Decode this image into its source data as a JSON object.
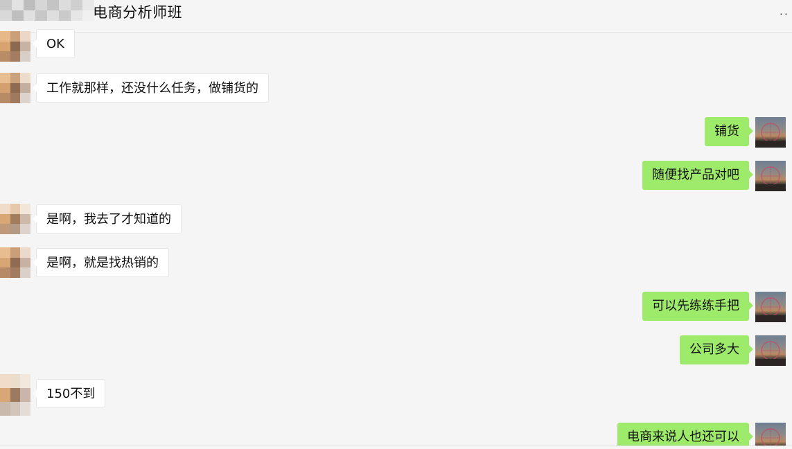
{
  "header": {
    "title": "电商分析师班",
    "more_label": "··"
  },
  "messages": [
    {
      "side": "left",
      "text": "OK"
    },
    {
      "side": "left",
      "text": "工作就那样，还没什么任务，做铺货的"
    },
    {
      "side": "right",
      "text": "铺货"
    },
    {
      "side": "right",
      "text": "随便找产品对吧"
    },
    {
      "side": "left",
      "text": "是啊，我去了才知道的"
    },
    {
      "side": "left",
      "text": "是啊，就是找热销的"
    },
    {
      "side": "right",
      "text": "可以先练练手把"
    },
    {
      "side": "right",
      "text": "公司多大"
    },
    {
      "side": "left",
      "text": "150不到"
    },
    {
      "side": "right",
      "text": "电商来说人也还可以"
    }
  ],
  "colors": {
    "background": "#f5f5f5",
    "bubble_self": "#9eea6a",
    "bubble_other": "#ffffff"
  }
}
